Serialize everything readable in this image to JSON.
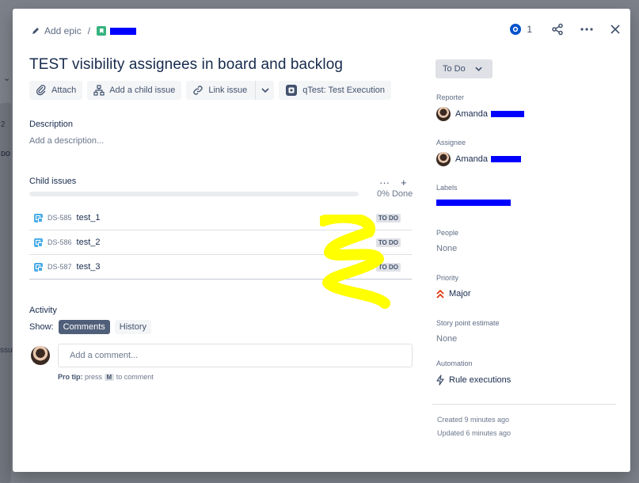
{
  "background": {
    "partial_count": "2",
    "partial_status": "DO",
    "partial_text": "ssue"
  },
  "header": {
    "add_epic": "Add epic",
    "separator": "/",
    "watch_count": "1"
  },
  "issue": {
    "title": "TEST visibility assignees in board and backlog"
  },
  "toolbar": {
    "attach": "Attach",
    "add_child": "Add a child issue",
    "link_issue": "Link issue",
    "qtest": "qTest: Test Execution"
  },
  "description": {
    "heading": "Description",
    "placeholder": "Add a description..."
  },
  "child_issues": {
    "heading": "Child issues",
    "more": "···",
    "add": "+",
    "percent_done": "0% Done",
    "progress": 0,
    "items": [
      {
        "key": "DS-585",
        "summary": "test_1",
        "status": "TO DO"
      },
      {
        "key": "DS-586",
        "summary": "test_2",
        "status": "TO DO"
      },
      {
        "key": "DS-587",
        "summary": "test_3",
        "status": "TO DO"
      }
    ]
  },
  "activity": {
    "heading": "Activity",
    "show_label": "Show:",
    "tabs": [
      "Comments",
      "History"
    ],
    "comment_placeholder": "Add a comment...",
    "protip_label": "Pro tip:",
    "protip_press": "press",
    "protip_key": "M",
    "protip_rest": "to comment"
  },
  "sidebar": {
    "status": "To Do",
    "reporter_label": "Reporter",
    "reporter_name": "Amanda",
    "assignee_label": "Assignee",
    "assignee_name": "Amanda",
    "labels_label": "Labels",
    "people_label": "People",
    "people_value": "None",
    "priority_label": "Priority",
    "priority_value": "Major",
    "sp_label": "Story point estimate",
    "sp_value": "None",
    "automation_label": "Automation",
    "automation_value": "Rule executions",
    "created": "Created 9 minutes ago",
    "updated": "Updated 6 minutes ago"
  },
  "colors": {
    "redaction": "#0000ff",
    "scribble": "#ffff00",
    "priority": "#de350b",
    "story": "#36b37e",
    "subtask": "#4bade8"
  }
}
